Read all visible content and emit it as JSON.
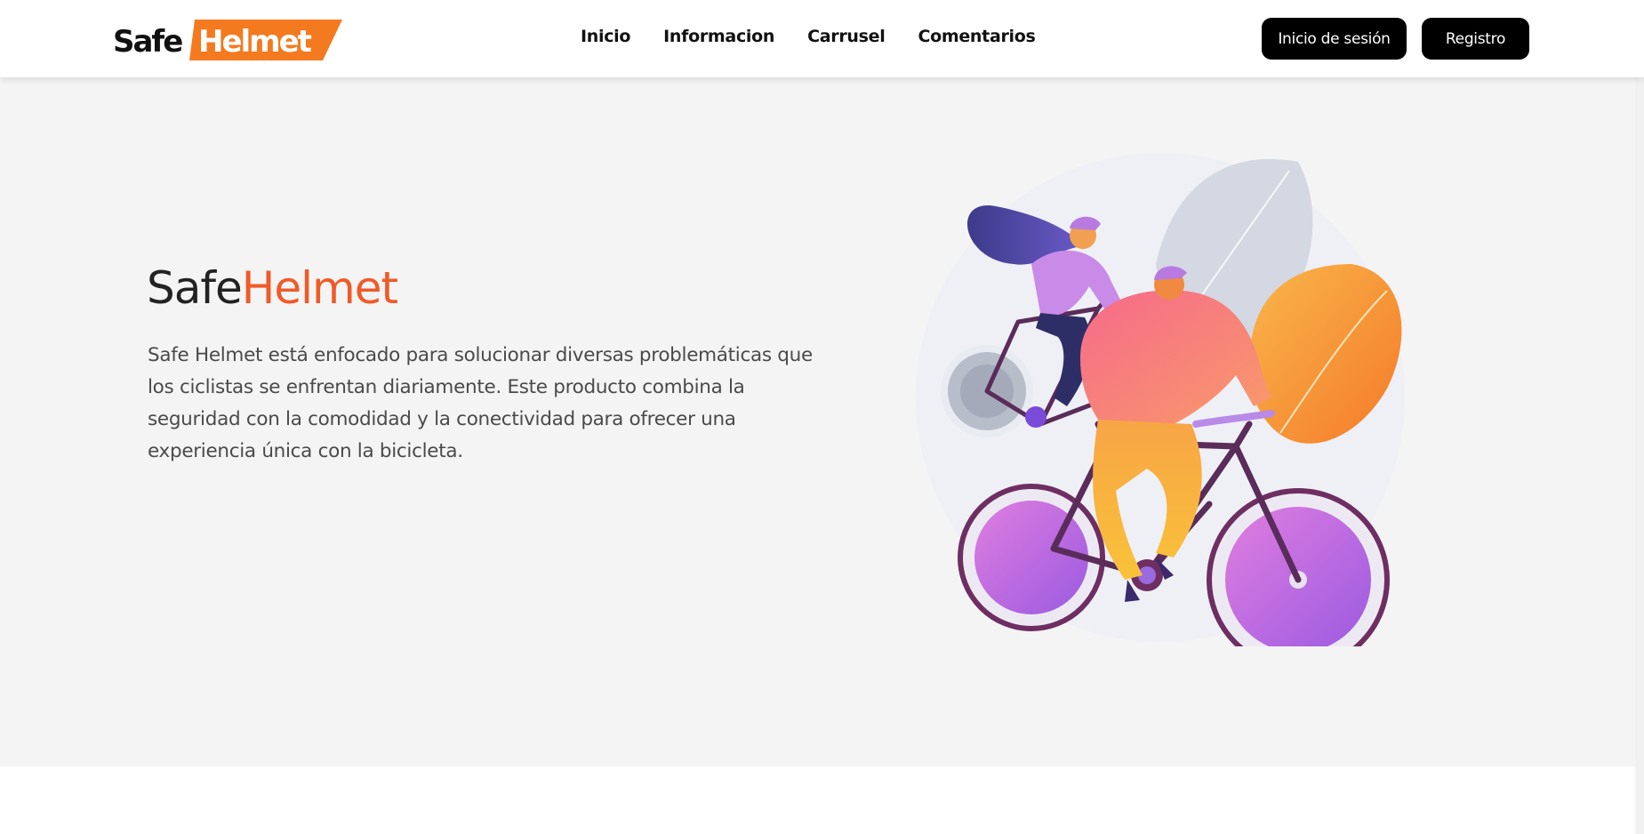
{
  "brand": {
    "part1": "Safe",
    "part2": "Helmet",
    "accent_color": "#f47a1f"
  },
  "nav": {
    "links": [
      "Inicio",
      "Informacion",
      "Carrusel",
      "Comentarios"
    ]
  },
  "auth": {
    "login_label": "Inicio de sesión",
    "register_label": "Registro"
  },
  "hero": {
    "title_part1": "Safe",
    "title_part2": "Helmet",
    "title_accent_color": "#f05a28",
    "description": "Safe Helmet está enfocado para solucionar diversas problemáticas que los ciclistas se enfrentan diariamente. Este producto combina la seguridad con la comodidad y la conectividad para ofrecer una experiencia única con la bicicleta.",
    "illustration": "two-cyclists-illustration"
  }
}
